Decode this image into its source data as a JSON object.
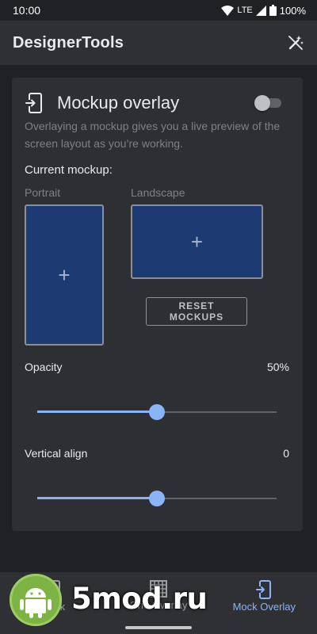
{
  "status_bar": {
    "time": "10:00",
    "network": "LTE",
    "battery": "100%",
    "icons": [
      "wifi-icon",
      "signal-icon",
      "battery-icon"
    ]
  },
  "app_bar": {
    "title": "DesignerTools",
    "action_icon": "magic-wand-off-icon"
  },
  "card": {
    "title": "Mockup overlay",
    "icon": "mockup-overlay-icon",
    "toggle_on": false,
    "description": "Overlaying a mockup gives you a live preview of the screen layout as you’re working.",
    "current_mockup_label": "Current mockup:",
    "portrait_label": "Portrait",
    "landscape_label": "Landscape",
    "add_symbol": "+",
    "reset_label": "RESET MOCKUPS",
    "opacity": {
      "label": "Opacity",
      "value_text": "50%",
      "value": 50,
      "max": 100
    },
    "vertical_align": {
      "label": "Vertical align",
      "value_text": "0",
      "value": 0,
      "min": -100,
      "max": 100
    }
  },
  "bottom_nav": {
    "items": [
      {
        "label": "Mock",
        "icon": "mock-icon",
        "active": false
      },
      {
        "label": "Grid Overlay",
        "icon": "grid-icon",
        "active": false
      },
      {
        "label": "Mock Overlay",
        "icon": "mock-overlay-icon",
        "active": true
      }
    ]
  },
  "watermark": {
    "text": "5mod.ru",
    "logo": "android-icon"
  },
  "colors": {
    "background": "#202124",
    "surface": "#2e2f33",
    "accent": "#8ab4f8",
    "mockup_fill": "#1e3a73",
    "watermark_green": "#7cb342"
  }
}
